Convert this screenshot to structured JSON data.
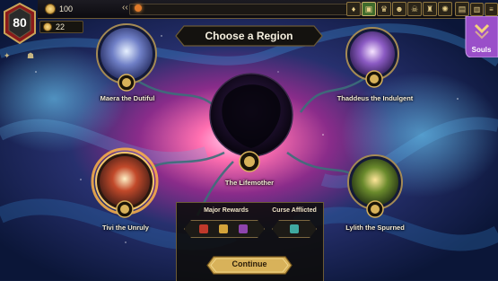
{
  "top_bar": {
    "hp": "80",
    "gold": "100",
    "keys": "22"
  },
  "header": {
    "title": "Choose a Region"
  },
  "souls": {
    "label": "Souls"
  },
  "regions": [
    {
      "name": "Maera the Dutiful",
      "state": "available"
    },
    {
      "name": "Thaddeus the Indulgent",
      "state": "available"
    },
    {
      "name": "The Lifemother",
      "state": "current"
    },
    {
      "name": "Tivi the Unruly",
      "state": "selected"
    },
    {
      "name": "Lylith the Spurned",
      "state": "available"
    }
  ],
  "panel": {
    "major_rewards_label": "Major Rewards",
    "curse_label": "Curse Afflicted",
    "continue_label": "Continue"
  },
  "colors": {
    "accent_gold": "#d8b25a",
    "souls_purple": "#9a4fc9",
    "selected_ring": "#ffb347"
  }
}
